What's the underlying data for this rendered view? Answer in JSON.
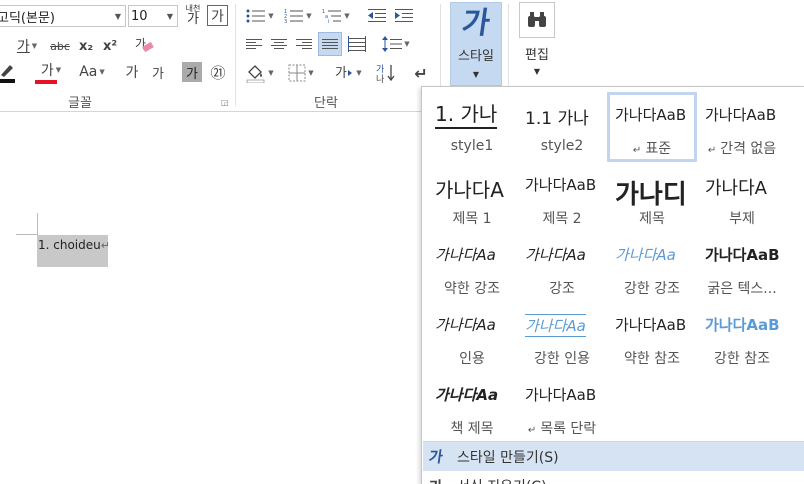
{
  "font": {
    "name": "고딕(본문)",
    "size": "10",
    "row2": {
      "underline_ga": "가",
      "strike": "abc",
      "sub": "x₂",
      "sup": "x²"
    },
    "row3": {
      "highlight": "가",
      "font_color": "가",
      "case": "Aa",
      "grow": "가",
      "shrink": "가",
      "shade": "가",
      "enclose": "㉑"
    },
    "phonetic_top": "내천",
    "phonetic_bottom": "가",
    "group_label": "글꼴"
  },
  "paragraph": {
    "group_label": "단락",
    "sort_label": "가",
    "show_marks": "↵"
  },
  "styles_button": {
    "icon": "가",
    "label": "스타일"
  },
  "edit_button": {
    "label": "편집"
  },
  "document": {
    "text": "1. choideu"
  },
  "gallery": {
    "tiles": [
      {
        "sample": "1.  가나",
        "name": "style1"
      },
      {
        "sample": "1.1   가나",
        "name": "style2"
      },
      {
        "sample": "가나다AaB",
        "name": "표준",
        "para_mark": "↵",
        "selected": true
      },
      {
        "sample": "가나다AaB",
        "name": "간격 없음",
        "para_mark": "↵"
      },
      {
        "sample": "가나다A",
        "name": "제목 1"
      },
      {
        "sample": "가나다AaB",
        "name": "제목 2"
      },
      {
        "sample": "가나디",
        "name": "제목"
      },
      {
        "sample": "가나다A",
        "name": "부제"
      },
      {
        "sample": "가나다Aa",
        "name": "약한 강조"
      },
      {
        "sample": "가나다Aa",
        "name": "강조"
      },
      {
        "sample": "가나다Aa",
        "name": "강한 강조"
      },
      {
        "sample": "가나다AaB",
        "name": "굵은 텍스..."
      },
      {
        "sample": "가나다Aa",
        "name": "인용"
      },
      {
        "sample": "가나다Aa",
        "name": "강한 인용"
      },
      {
        "sample": "가나다AaB",
        "name": "약한 참조"
      },
      {
        "sample": "가나다AaB",
        "name": "강한 참조"
      },
      {
        "sample": "가나다Aa",
        "name": "책 제목"
      },
      {
        "sample": "가나다AaB",
        "name": "목록 단락",
        "para_mark": "↵"
      }
    ],
    "menu": [
      {
        "icon": "가",
        "label": "스타일 만들기(S)"
      },
      {
        "icon": "가",
        "label": "서식 지우기(C)"
      }
    ]
  },
  "colors": {
    "accent_blue": "#2b579a",
    "highlight": "#c5d9f0",
    "font_red": "#e81123",
    "emphasis_blue": "#5b9bd5"
  }
}
